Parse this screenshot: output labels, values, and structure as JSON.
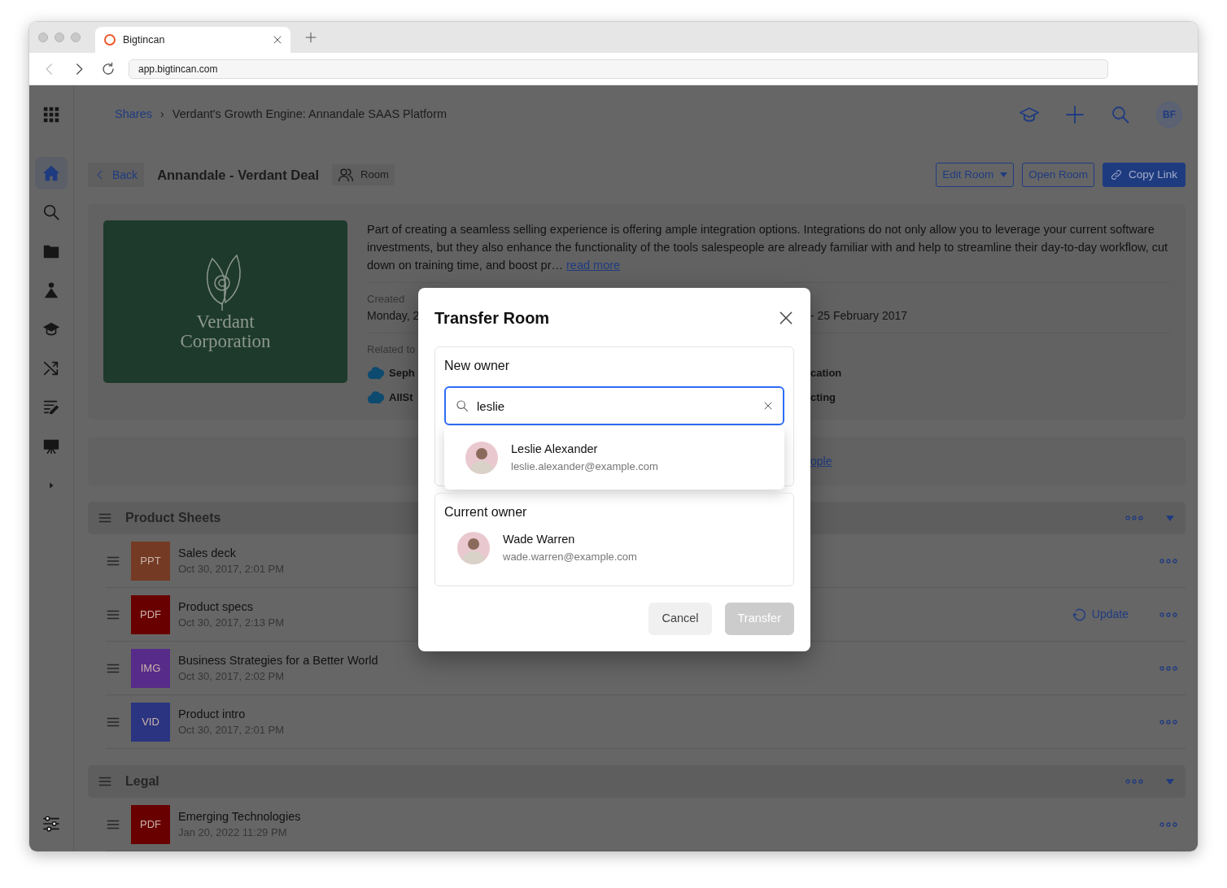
{
  "browser": {
    "tab_title": "Bigtincan",
    "url": "app.bigtincan.com",
    "nav": [
      {
        "kind": "back",
        "disabled": true
      },
      {
        "kind": "forward",
        "disabled": false
      },
      {
        "kind": "reload",
        "disabled": false
      }
    ]
  },
  "sidebar": {
    "items": [
      {
        "kind": "apps",
        "selected": false
      },
      {
        "kind": "home",
        "selected": true
      },
      {
        "kind": "search",
        "selected": false
      },
      {
        "kind": "folder",
        "selected": false
      },
      {
        "kind": "network",
        "selected": false
      },
      {
        "kind": "learn",
        "selected": false
      },
      {
        "kind": "shuffle",
        "selected": false
      },
      {
        "kind": "notes",
        "selected": false
      },
      {
        "kind": "present",
        "selected": false
      },
      {
        "kind": "expand",
        "selected": false
      },
      {
        "kind": "settings",
        "selected": false
      }
    ]
  },
  "header": {
    "breadcrumb": [
      {
        "label": "Shares",
        "kind": "link"
      },
      {
        "label": "Verdant's Growth Engine: Annandale SAAS Platform",
        "kind": "current"
      }
    ],
    "separator": "›",
    "tools": [
      {
        "kind": "learn"
      },
      {
        "kind": "add"
      },
      {
        "kind": "search"
      }
    ],
    "avatar_initials": "BF"
  },
  "room": {
    "back": "Back",
    "title": "Annandale - Verdant Deal",
    "badge": "Room",
    "actions": [
      {
        "label": "Edit Room",
        "kind": "dropdown"
      },
      {
        "label": "Open Room",
        "kind": "outline"
      },
      {
        "label": "Copy Link",
        "kind": "primary"
      }
    ]
  },
  "details": {
    "logo_lines": [
      "Verdant",
      "Corporation"
    ],
    "description": "Part of creating a seamless selling experience is offering ample integration options. Integrations do not only allow you to leverage your current software investments, but they also enhance the functionality of the tools salespeople are already familiar with and help to streamline their day-to-day workflow, cut down on training time, and boost pr…",
    "read_more": "read more",
    "created_label": "Created",
    "created_value": "Monday, 2",
    "created_value_right": "- 25 February 2017",
    "related_label": "Related to",
    "related": [
      {
        "left": "Seph",
        "right": "cation"
      },
      {
        "left": "AllSt",
        "right": "cting"
      }
    ]
  },
  "banner": {
    "link": "ople"
  },
  "sections": [
    {
      "title": "Product Sheets",
      "items": [
        {
          "type": "PPT",
          "color": "#743a24",
          "name": "Sales deck",
          "date": "Oct 30, 2017, 2:01 PM"
        },
        {
          "type": "PDF",
          "color": "#680000",
          "name": "Product specs",
          "date": "Oct 30, 2017, 2:13 PM",
          "action": "Update"
        },
        {
          "type": "IMG",
          "color": "#572b89",
          "name": "Business Strategies for a Better World",
          "date": "Oct 30, 2017, 2:02 PM"
        },
        {
          "type": "VID",
          "color": "#2b3480",
          "name": "Product intro",
          "date": "Oct 30, 2017, 2:01 PM"
        }
      ]
    },
    {
      "title": "Legal",
      "items": [
        {
          "type": "PDF",
          "color": "#680000",
          "name": "Emerging Technologies",
          "date": "Jan 20, 2022 11:29 PM"
        }
      ]
    }
  ],
  "modal": {
    "title": "Transfer Room",
    "new_owner_label": "New owner",
    "search_value": "leslie",
    "results": [
      {
        "name": "Leslie Alexander",
        "email": "leslie.alexander@example.com"
      }
    ],
    "current_owner_label": "Current owner",
    "current_owner": {
      "name": "Wade Warren",
      "email": "wade.warren@example.com"
    },
    "buttons": [
      {
        "label": "Cancel",
        "kind": "secondary",
        "disabled": false
      },
      {
        "label": "Transfer",
        "kind": "primary",
        "disabled": true
      }
    ]
  }
}
